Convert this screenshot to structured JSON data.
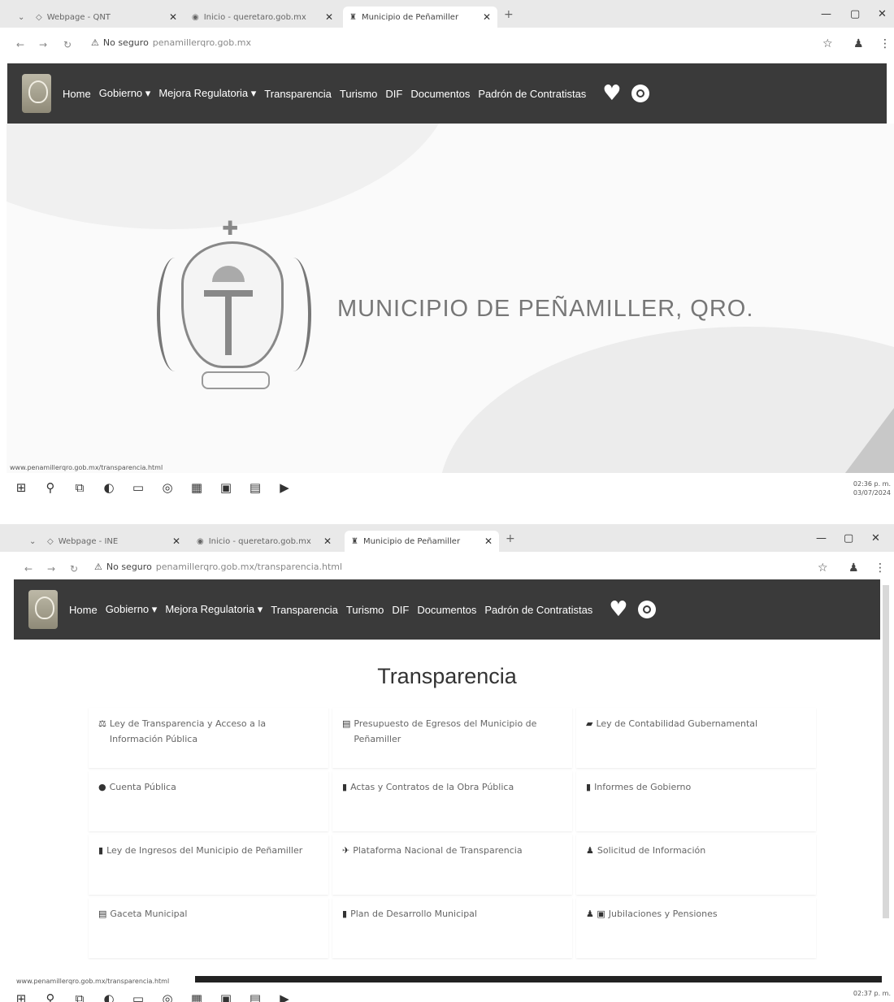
{
  "screen1": {
    "tabs": [
      {
        "title": "Webpage - QNT"
      },
      {
        "title": "Inicio - queretaro.gob.mx"
      },
      {
        "title": "Municipio de Peñamiller"
      }
    ],
    "address": {
      "security_label": "No seguro",
      "url": "penamillerqro.gob.mx"
    },
    "nav": [
      "Home",
      "Gobierno ▾",
      "Mejora Regulatoria ▾",
      "Transparencia",
      "Turismo",
      "DIF",
      "Documentos",
      "Padrón de Contratistas"
    ],
    "hero_title": "MUNICIPIO DE PEÑAMILLER, QRO.",
    "status_url": "www.penamillerqro.gob.mx/transparencia.html",
    "clock": {
      "time": "02:36 p. m.",
      "date": "03/07/2024"
    }
  },
  "screen2": {
    "tabs": [
      {
        "title": "Webpage - INE"
      },
      {
        "title": "Inicio - queretaro.gob.mx"
      },
      {
        "title": "Municipio de Peñamiller"
      }
    ],
    "address": {
      "security_label": "No seguro",
      "url": "penamillerqro.gob.mx/transparencia.html"
    },
    "nav": [
      "Home",
      "Gobierno ▾",
      "Mejora Regulatoria ▾",
      "Transparencia",
      "Turismo",
      "DIF",
      "Documentos",
      "Padrón de Contratistas"
    ],
    "page_title": "Transparencia",
    "cards": [
      {
        "icon": "⚖",
        "label": "Ley de Transparencia y Acceso a la Información Pública"
      },
      {
        "icon": "▤",
        "label": "Presupuesto de Egresos del Municipio de Peñamiller"
      },
      {
        "icon": "▰",
        "label": "Ley de Contabilidad Gubernamental"
      },
      {
        "icon": "●",
        "label": "Cuenta Pública"
      },
      {
        "icon": "▮",
        "label": "Actas y Contratos de la Obra Pública"
      },
      {
        "icon": "▮",
        "label": "Informes de Gobierno"
      },
      {
        "icon": "▮",
        "label": "Ley de Ingresos del Municipio de Peñamiller"
      },
      {
        "icon": "✈",
        "label": "Plataforma Nacional de Transparencia"
      },
      {
        "icon": "♟",
        "label": "Solicitud de Información"
      },
      {
        "icon": "▤",
        "label": "Gaceta Municipal"
      },
      {
        "icon": "▮",
        "label": "Plan de Desarrollo Municipal"
      },
      {
        "icon": "♟ ▣",
        "label": "Jubilaciones y Pensiones"
      }
    ],
    "status_url": "www.penamillerqro.gob.mx/transparencia.html",
    "clock": {
      "time": "02:37 p. m."
    }
  }
}
